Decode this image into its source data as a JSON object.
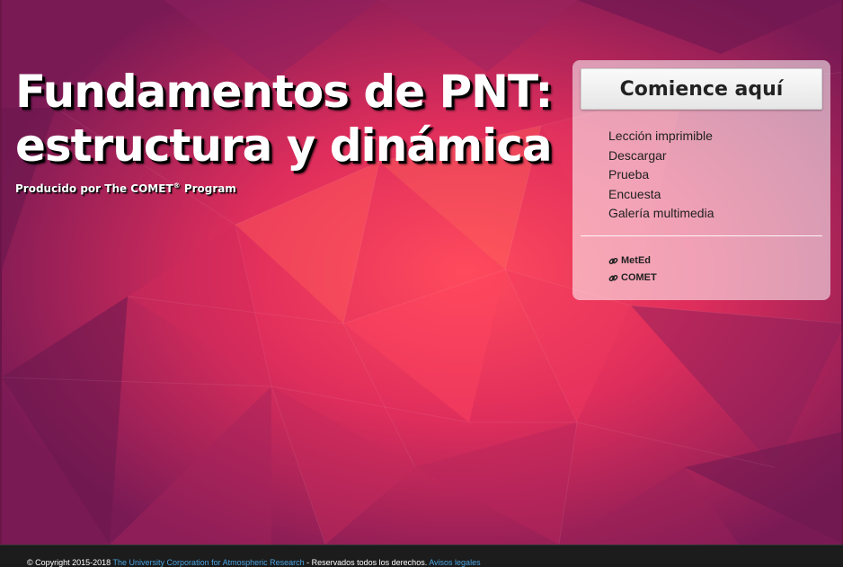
{
  "hero": {
    "title_line1": "Fundamentos de PNT:",
    "title_line2": "estructura y dinámica",
    "producer_prefix": "Producido por The COMET",
    "producer_reg": "®",
    "producer_suffix": " Program"
  },
  "panel": {
    "start_label": "Comience aquí",
    "menu": [
      "Lección imprimible",
      "Descargar",
      "Prueba",
      "Encuesta",
      "Galería multimedia"
    ],
    "links": [
      {
        "label": "MetEd",
        "icon": "link-icon"
      },
      {
        "label": "COMET",
        "icon": "link-icon"
      }
    ]
  },
  "footer": {
    "copyright": "© Copyright 2015-2018 ",
    "org_link": "The University Corporation for Atmospheric Research",
    "rights": " - Reservados todos los derechos. ",
    "legal_link": "Avisos legales"
  },
  "colors": {
    "hero_base": "#8a1f5c",
    "hero_center": "#ff4a5a",
    "footer_bg": "#1c1c1c",
    "link": "#4aa3df"
  }
}
